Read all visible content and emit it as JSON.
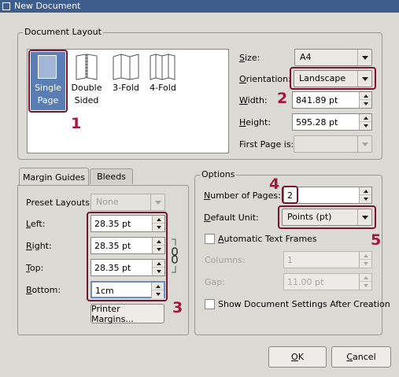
{
  "window": {
    "title": "New Document"
  },
  "document_layout": {
    "group_title": "Document Layout",
    "layouts": [
      {
        "line1": "Single",
        "line2": "Page",
        "selected": true
      },
      {
        "line1": "Double",
        "line2": "Sided"
      },
      {
        "line1": "3-Fold",
        "line2": ""
      },
      {
        "line1": "4-Fold",
        "line2": ""
      }
    ],
    "size_label": "Size:",
    "size_value": "A4",
    "orientation_label": "Orientation:",
    "orientation_value": "Landscape",
    "width_label": "Width:",
    "width_value": "841.89 pt",
    "height_label": "Height:",
    "height_value": "595.28 pt",
    "first_page_label": "First Page is:",
    "first_page_value": ""
  },
  "tabs": {
    "margin_guides": "Margin Guides",
    "bleeds": "Bleeds"
  },
  "margins": {
    "preset_label": "Preset Layouts:",
    "preset_value": "None",
    "left_label": "Left:",
    "left_value": "28.35 pt",
    "right_label": "Right:",
    "right_value": "28.35 pt",
    "top_label": "Top:",
    "top_value": "28.35 pt",
    "bottom_label": "Bottom:",
    "bottom_value": "1cm",
    "printer_margins_label": "Printer Margins..."
  },
  "options": {
    "group_title": "Options",
    "pages_label": "Number of Pages:",
    "pages_value": "2",
    "unit_label": "Default Unit:",
    "unit_value": "Points (pt)",
    "auto_frames_label": "Automatic Text Frames",
    "columns_label": "Columns:",
    "columns_value": "1",
    "gap_label": "Gap:",
    "gap_value": "11.00 pt",
    "show_settings_label": "Show Document Settings After Creation"
  },
  "buttons": {
    "ok": "OK",
    "cancel": "Cancel"
  },
  "annotations": [
    "1",
    "2",
    "3",
    "4",
    "5"
  ],
  "colors": {
    "annotation": "#a3173a",
    "titlebar": "#3d5d8f",
    "selection": "#5a7db4"
  }
}
